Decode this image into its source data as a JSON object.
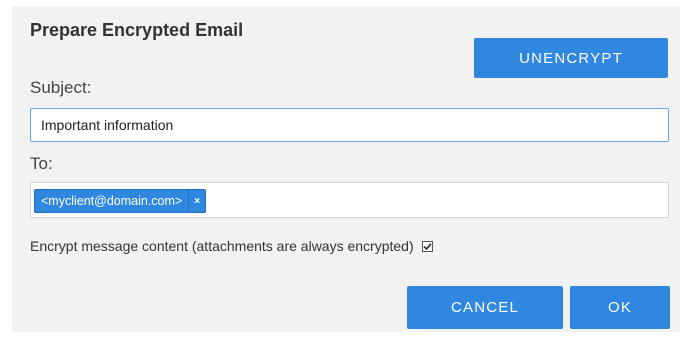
{
  "dialog": {
    "title": "Prepare Encrypted Email",
    "unencrypt_label": "UNENCRYPT",
    "subject": {
      "label": "Subject:",
      "value": "Important information"
    },
    "to": {
      "label": "To:",
      "recipients": [
        {
          "address": "<myclient@domain.com>",
          "remove_glyph": "×"
        }
      ]
    },
    "encrypt_option": {
      "label": "Encrypt message content (attachments are always encrypted)",
      "checked": true,
      "icon": "check-icon"
    },
    "cancel_label": "CANCEL",
    "ok_label": "OK"
  },
  "colors": {
    "accent": "#2f87e0",
    "panel": "#f2f2f2"
  }
}
